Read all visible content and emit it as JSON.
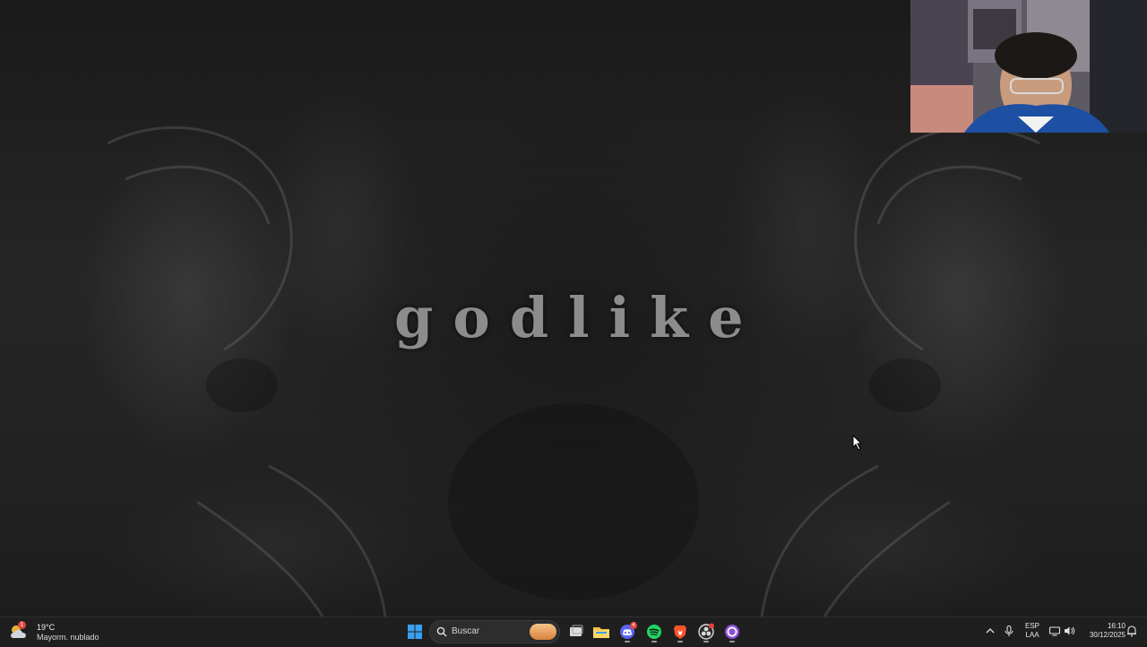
{
  "wallpaper": {
    "title": "godlike"
  },
  "taskbar": {
    "weather": {
      "badge": "1",
      "temperature": "19°C",
      "condition": "Mayorm. nublado",
      "icon": "partly-cloudy-icon"
    },
    "search": {
      "placeholder": "Buscar"
    },
    "apps": [
      {
        "name": "start-button",
        "icon": "windows-logo-icon"
      },
      {
        "name": "task-view",
        "icon": "task-view-icon"
      },
      {
        "name": "file-explorer",
        "icon": "folder-icon"
      },
      {
        "name": "discord",
        "icon": "discord-icon",
        "badge": "4"
      },
      {
        "name": "spotify",
        "icon": "spotify-icon"
      },
      {
        "name": "brave",
        "icon": "brave-icon"
      },
      {
        "name": "obs",
        "icon": "obs-icon"
      },
      {
        "name": "app-circle",
        "icon": "purple-circle-icon"
      }
    ],
    "tray": {
      "language_line1": "ESP",
      "language_line2": "LAA",
      "time": "16:10",
      "date": "30/12/2025"
    }
  },
  "colors": {
    "taskbar_bg": "#1f1f1f",
    "windows_blue": "#3ba0f0",
    "spotify_green": "#1ed760",
    "discord_blurple": "#5865f2",
    "brave_orange": "#fb542b",
    "folder_yellow": "#f4c243",
    "purple": "#8a4fd8"
  }
}
